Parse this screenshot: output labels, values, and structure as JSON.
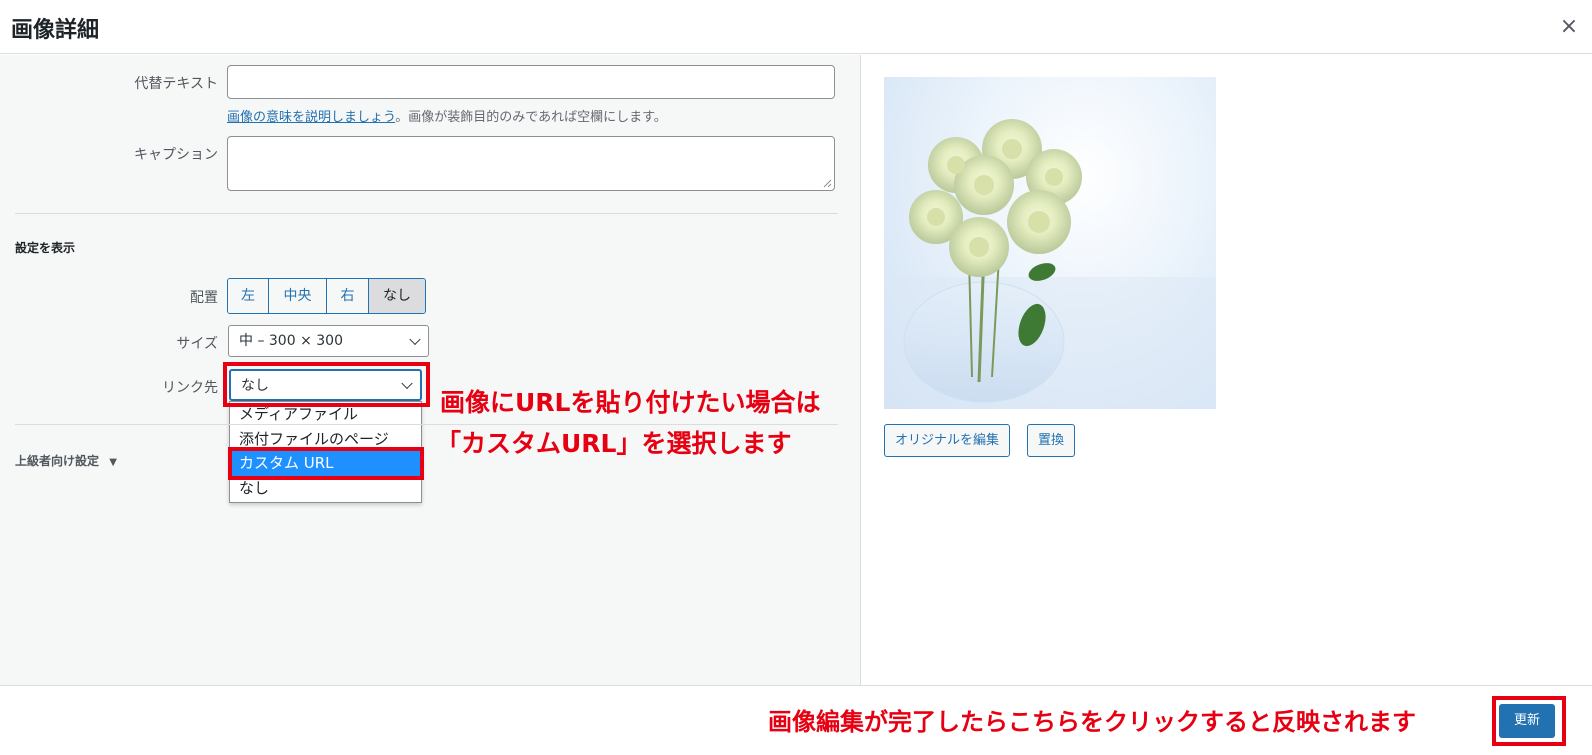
{
  "header": {
    "title": "画像詳細",
    "close_symbol": "×"
  },
  "fields": {
    "alt_text": {
      "label": "代替テキスト",
      "value": ""
    },
    "alt_help": {
      "link_text": "画像の意味を説明しましょう",
      "rest": "。画像が装飾目的のみであれば空欄にします。"
    },
    "caption": {
      "label": "キャプション",
      "value": ""
    }
  },
  "display_settings": {
    "title": "設定を表示",
    "align": {
      "label": "配置",
      "options": [
        "左",
        "中央",
        "右",
        "なし"
      ],
      "selected": "なし"
    },
    "size": {
      "label": "サイズ",
      "value": "中 – 300 × 300"
    },
    "link": {
      "label": "リンク先",
      "value": "なし",
      "options": [
        "メディアファイル",
        "添付ファイルのページ",
        "カスタム URL",
        "なし"
      ],
      "highlighted": "カスタム URL"
    }
  },
  "advanced": {
    "label": "上級者向け設定",
    "arrow": "▼"
  },
  "preview": {
    "edit_original": "オリジナルを編集",
    "replace": "置換"
  },
  "annotations": {
    "link_hint_line1": "画像にURLを貼り付けたい場合は",
    "link_hint_line2": "「カスタムURL」を選択します",
    "update_hint": "画像編集が完了したらこちらをクリックすると反映されます"
  },
  "footer": {
    "update_button": "更新"
  },
  "colors": {
    "accent": "#2271b1",
    "annotation": "#e60012",
    "highlight": "#1e90ff"
  }
}
